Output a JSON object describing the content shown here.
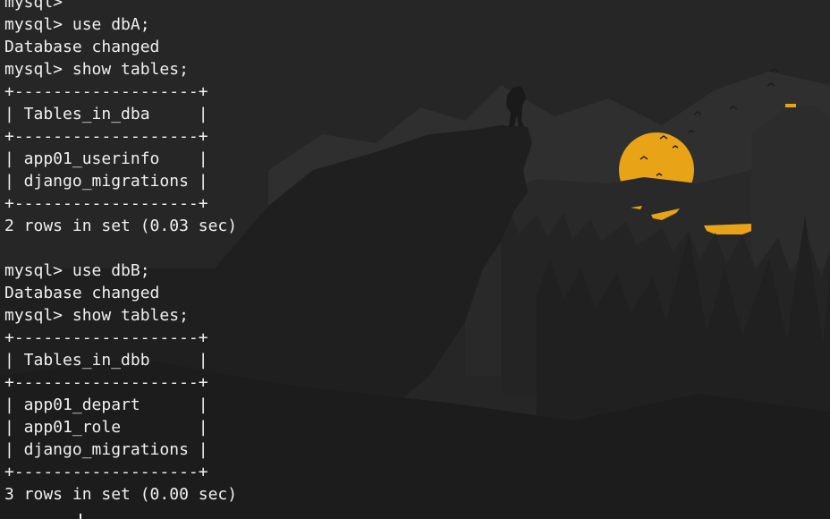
{
  "terminal": {
    "lines": [
      "mysql> ",
      "mysql> use dbA;",
      "Database changed",
      "mysql> show tables;",
      "+-------------------+",
      "| Tables_in_dba     |",
      "+-------------------+",
      "| app01_userinfo    |",
      "| django_migrations |",
      "+-------------------+",
      "2 rows in set (0.03 sec)",
      "",
      "mysql> use dbB;",
      "Database changed",
      "mysql> show tables;",
      "+-------------------+",
      "| Tables_in_dbb     |",
      "+-------------------+",
      "| app01_depart      |",
      "| app01_role        |",
      "| django_migrations |",
      "+-------------------+",
      "3 rows in set (0.00 sec)",
      ""
    ]
  },
  "wallpaper": {
    "scene": "silhouette-mountains-sunset",
    "colors": {
      "sky": "#262626",
      "far_mountains": "#2f2f2f",
      "mid_mountains": "#292929",
      "foreground": "#1f1f1f",
      "sun": "#e8a317",
      "lake": "#e8a317"
    }
  }
}
